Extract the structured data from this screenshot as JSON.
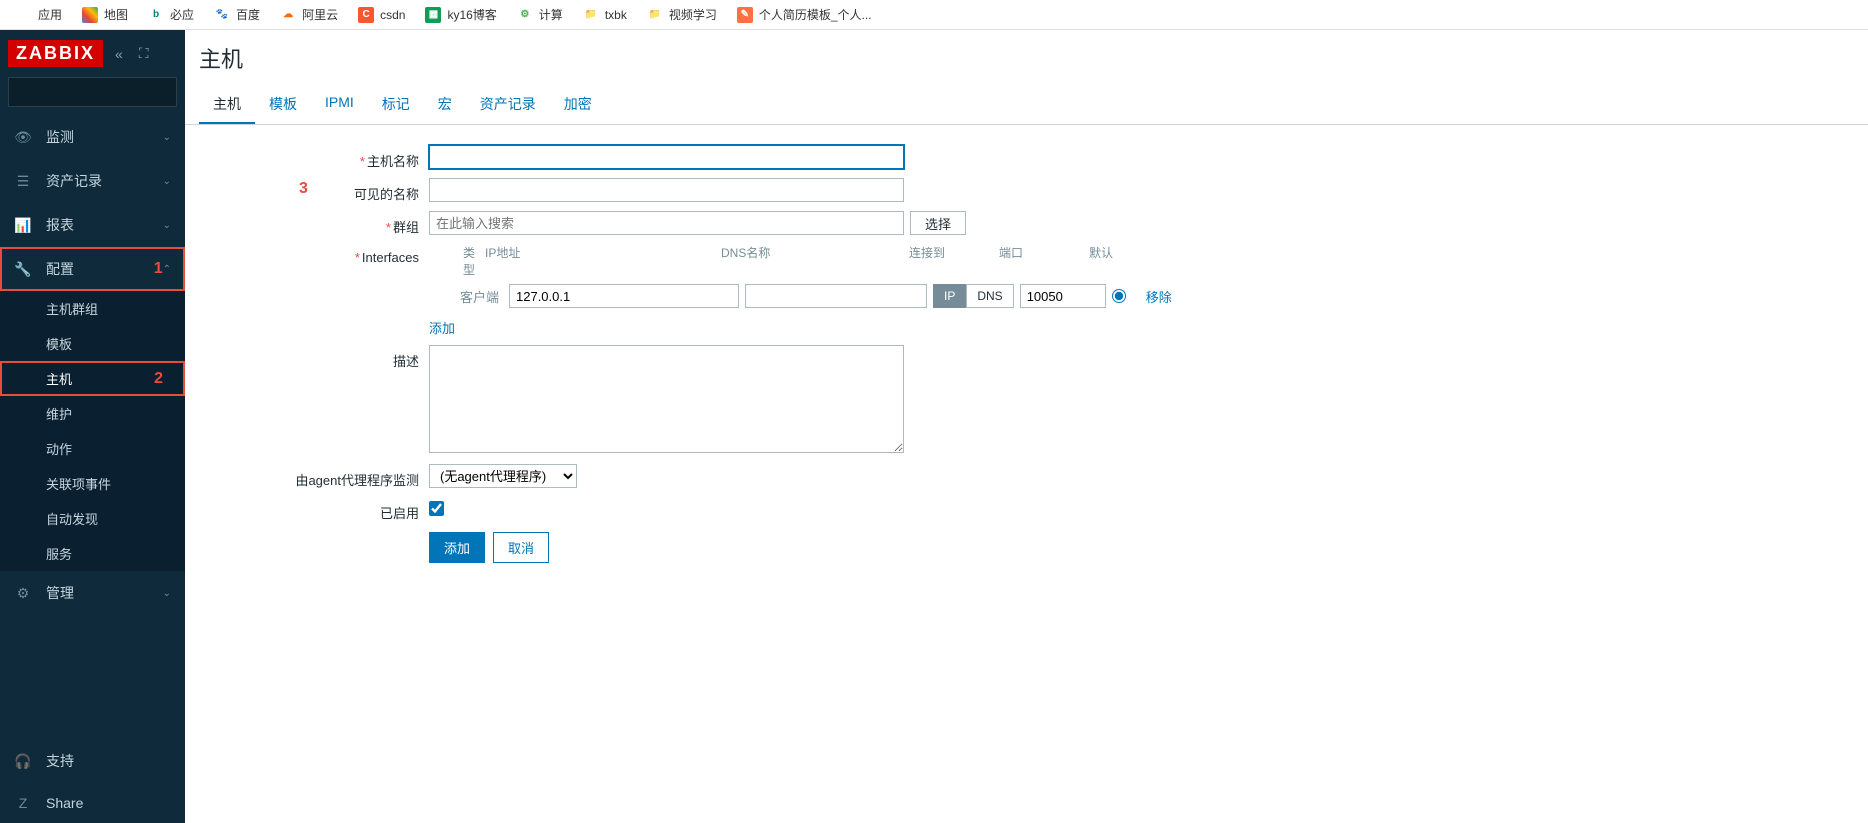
{
  "bookmarks": [
    {
      "label": "应用"
    },
    {
      "label": "地图"
    },
    {
      "label": "必应"
    },
    {
      "label": "百度"
    },
    {
      "label": "阿里云"
    },
    {
      "label": "csdn"
    },
    {
      "label": "ky16博客"
    },
    {
      "label": "计算"
    },
    {
      "label": "txbk"
    },
    {
      "label": "视频学习"
    },
    {
      "label": "个人简历模板_个人..."
    }
  ],
  "sidebar": {
    "logo": "ZABBIX",
    "menu": [
      {
        "label": "监测"
      },
      {
        "label": "资产记录"
      },
      {
        "label": "报表"
      },
      {
        "label": "配置",
        "annotation": "1"
      },
      {
        "label": "管理"
      }
    ],
    "submenu_config": [
      {
        "label": "主机群组"
      },
      {
        "label": "模板"
      },
      {
        "label": "主机",
        "annotation": "2"
      },
      {
        "label": "维护"
      },
      {
        "label": "动作"
      },
      {
        "label": "关联项事件"
      },
      {
        "label": "自动发现"
      },
      {
        "label": "服务"
      }
    ],
    "footer": [
      {
        "label": "支持"
      },
      {
        "label": "Share"
      }
    ]
  },
  "page": {
    "title": "主机",
    "annotation3": "3"
  },
  "tabs": [
    {
      "label": "主机",
      "active": true
    },
    {
      "label": "模板"
    },
    {
      "label": "IPMI"
    },
    {
      "label": "标记"
    },
    {
      "label": "宏"
    },
    {
      "label": "资产记录"
    },
    {
      "label": "加密"
    }
  ],
  "form": {
    "host_name_label": "主机名称",
    "visible_name_label": "可见的名称",
    "groups_label": "群组",
    "groups_placeholder": "在此输入搜索",
    "select_btn": "选择",
    "interfaces_label": "Interfaces",
    "iface_headers": {
      "type": "类型",
      "ip": "IP地址",
      "dns": "DNS名称",
      "connect": "连接到",
      "port": "端口",
      "default": "默认"
    },
    "agent_label": "客户端",
    "ip_value": "127.0.0.1",
    "dns_value": "",
    "toggle_ip": "IP",
    "toggle_dns": "DNS",
    "port_value": "10050",
    "remove_label": "移除",
    "add_iface_label": "添加",
    "description_label": "描述",
    "proxy_label": "由agent代理程序监测",
    "proxy_value": "(无agent代理程序)",
    "enabled_label": "已启用",
    "submit_label": "添加",
    "cancel_label": "取消"
  }
}
